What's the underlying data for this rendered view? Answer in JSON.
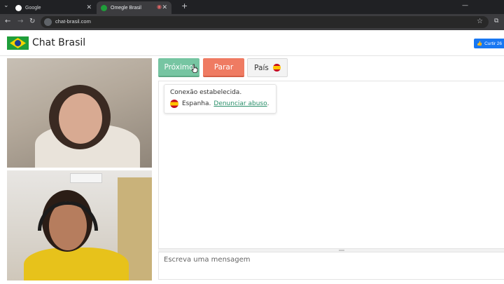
{
  "browser": {
    "tabs": [
      {
        "title": "Google",
        "active": false
      },
      {
        "title": "Omegle Brasil",
        "active": true
      }
    ],
    "url": "chat-brasil.com"
  },
  "header": {
    "title": "Chat Brasil",
    "fb_like": "Curtir 26"
  },
  "controls": {
    "next_label": "Próximo",
    "stop_label": "Parar",
    "country_label": "País"
  },
  "chat": {
    "status_message": "Conexão estabelecida.",
    "stranger_country": "Espanha.",
    "report_link": "Denunciar abuso",
    "report_suffix": "."
  },
  "input": {
    "placeholder": "Escreva uma mensagem"
  },
  "colors": {
    "next_button": "#76c5a2",
    "stop_button": "#ef7b62",
    "link": "#2a8f6a",
    "fb_blue": "#1877f2"
  }
}
